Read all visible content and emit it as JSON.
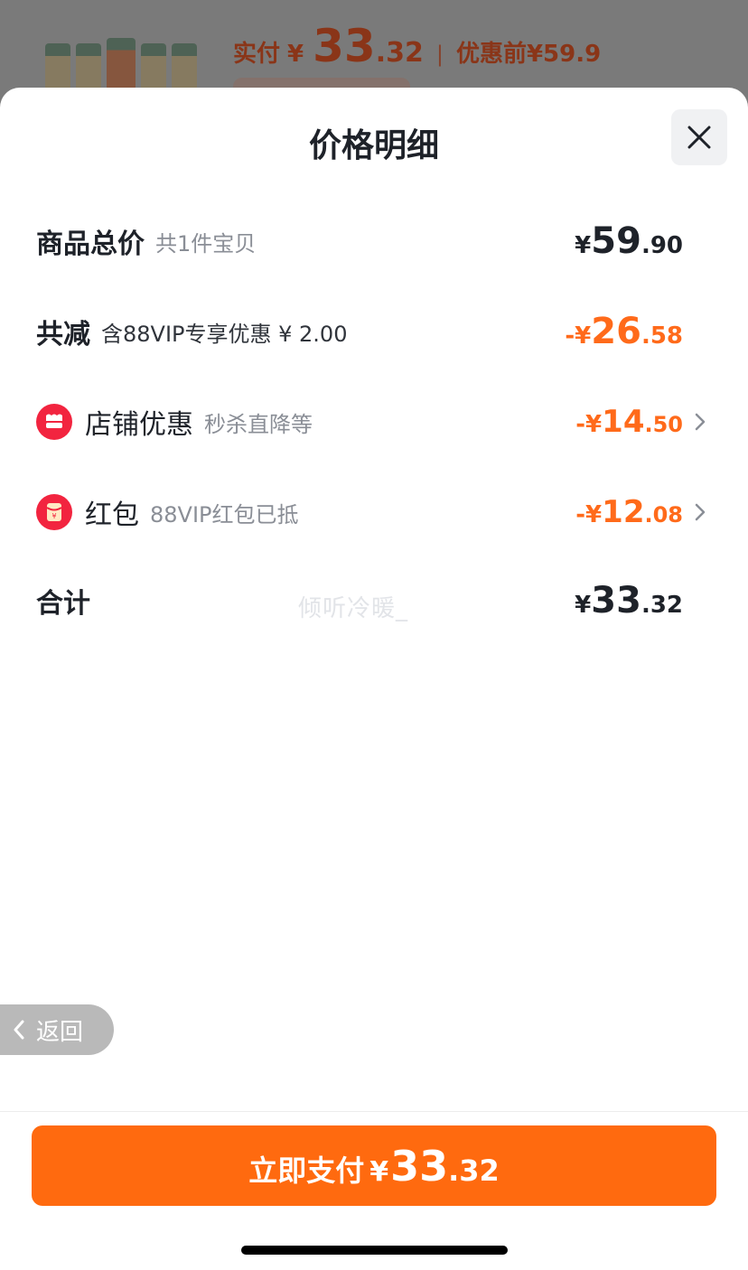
{
  "background": {
    "paid_label": "实付",
    "currency": "¥",
    "paid_int": "33",
    "paid_dec": ".32",
    "separator": "|",
    "pre_discount_label": "优惠前",
    "pre_discount_value": "¥59.9"
  },
  "sheet": {
    "title": "价格明细",
    "close_icon": "close-icon"
  },
  "rows": {
    "total": {
      "label": "商品总价",
      "sub": "共1件宝贝",
      "currency": "¥",
      "int": "59",
      "dec": ".90"
    },
    "reduction": {
      "label": "共减",
      "sub": "含88VIP专享优惠 ¥ 2.00",
      "prefix": "-¥",
      "int": "26",
      "dec": ".58"
    },
    "store_discount": {
      "icon": "shop-icon",
      "label": "店铺优惠",
      "sub": "秒杀直降等",
      "prefix": "-¥",
      "int": "14",
      "dec": ".50"
    },
    "red_packet": {
      "icon": "red-packet-icon",
      "label": "红包",
      "sub": "88VIP红包已抵",
      "prefix": "-¥",
      "int": "12",
      "dec": ".08"
    },
    "subtotal": {
      "label": "合计",
      "currency": "¥",
      "int": "33",
      "dec": ".32"
    }
  },
  "watermark": "倾听冷暖_",
  "back_button": {
    "label": "返回"
  },
  "pay_button": {
    "label": "立即支付",
    "currency": "¥",
    "int": "33",
    "dec": ".32"
  },
  "colors": {
    "accent": "#ff6a0f",
    "discount": "#ff6a1a",
    "text": "#1e2229",
    "muted": "#8a8e96"
  }
}
